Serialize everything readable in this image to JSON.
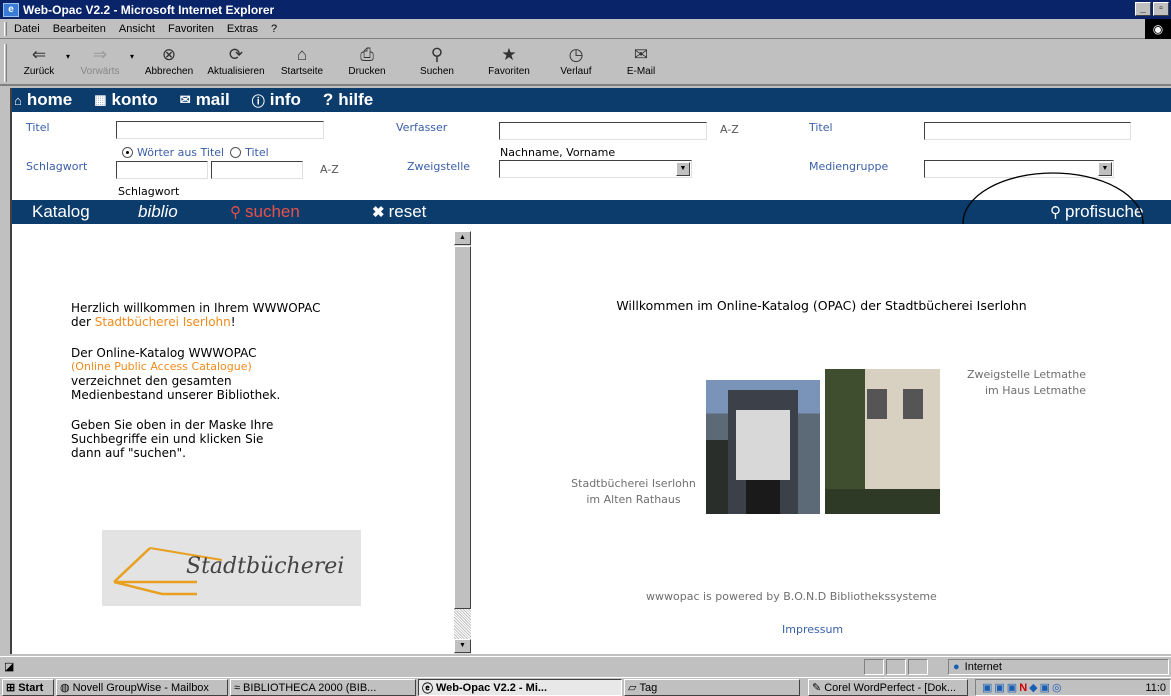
{
  "window": {
    "title": "Web-Opac V2.2 - Microsoft Internet Explorer",
    "minimize": "_",
    "maximize": "▫"
  },
  "menu": [
    "Datei",
    "Bearbeiten",
    "Ansicht",
    "Favoriten",
    "Extras",
    "?"
  ],
  "toolbar": [
    {
      "label": "Zurück",
      "icon": "⇐"
    },
    {
      "label": "Vorwärts",
      "icon": "⇒"
    },
    {
      "label": "Abbrechen",
      "icon": "⊗"
    },
    {
      "label": "Aktualisieren",
      "icon": "⟳"
    },
    {
      "label": "Startseite",
      "icon": "⌂"
    },
    {
      "label": "Drucken",
      "icon": "⎙"
    },
    {
      "label": "Suchen",
      "icon": "⚲"
    },
    {
      "label": "Favoriten",
      "icon": "★"
    },
    {
      "label": "Verlauf",
      "icon": "◷"
    },
    {
      "label": "E-Mail",
      "icon": "✉"
    }
  ],
  "nav": [
    {
      "label": "home",
      "icon": "⌂"
    },
    {
      "label": "konto",
      "icon": "▦"
    },
    {
      "label": "mail",
      "icon": "✉"
    },
    {
      "label": "info",
      "icon": "ⓘ"
    },
    {
      "label": "hilfe",
      "icon": "?"
    }
  ],
  "form": {
    "titel1_label": "Titel",
    "verfasser_label": "Verfasser",
    "titel2_label": "Titel",
    "schlagwort_label": "Schlagwort",
    "zweigstelle_label": "Zweigstelle",
    "mediengruppe_label": "Mediengruppe",
    "radio_woerter": "Wörter aus Titel",
    "radio_titel": "Titel",
    "az": "A-Z",
    "nachname_hint": "Nachname, Vorname",
    "schlagwort_hint": "Schlagwort"
  },
  "actions": {
    "katalog": "Katalog",
    "biblio": "biblio",
    "suchen": "suchen",
    "reset": "reset",
    "profisuche": "profisuche"
  },
  "left": {
    "welcome_1": "Herzlich willkommen in Ihrem WWWOPAC",
    "welcome_2a": "der ",
    "welcome_2b": "Stadtbücherei Iserlohn",
    "welcome_2c": "!",
    "p2_1": "Der Online-Katalog WWWOPAC",
    "p2_2": "(Online Public Access Catalogue)",
    "p2_3": "verzeichnet den gesamten",
    "p2_4": "Medienbestand unserer Bibliothek.",
    "p3_1": "Geben Sie oben in der Maske Ihre",
    "p3_2": "Suchbegriffe ein und klicken Sie",
    "p3_3": "dann auf \"suchen\".",
    "logo_text": "Stadtbücherei"
  },
  "right": {
    "title": "Willkommen im Online-Katalog (OPAC) der Stadtbücherei Iserlohn",
    "cap_left_1": "Stadtbücherei Iserlohn",
    "cap_left_2": "im Alten Rathaus",
    "cap_right_1": "Zweigstelle Letmathe",
    "cap_right_2": "im Haus Letmathe",
    "powered": "wwwopac is powered by B.O.N.D Bibliothekssysteme",
    "impressum": "Impressum"
  },
  "status": {
    "zone": "Internet"
  },
  "taskbar": {
    "start": "Start",
    "tasks": [
      "Novell GroupWise - Mailbox",
      "BIBLIOTHECA 2000 (BIB...",
      "Web-Opac V2.2 - Mi...",
      "Tag",
      "Corel WordPerfect - [Dok..."
    ],
    "clock": "11:0"
  },
  "colors": {
    "navy": "#0c3c6c",
    "label_blue": "#3a5fa8",
    "orange": "#f08a1a",
    "suchen_red": "#e8504a"
  }
}
